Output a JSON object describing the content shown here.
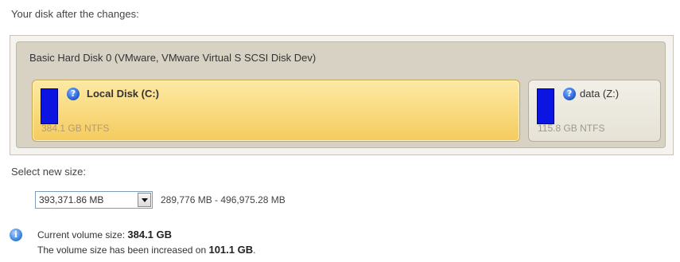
{
  "labels": {
    "after_changes": "Your disk after the changes:",
    "select_new_size": "Select new size:"
  },
  "disk": {
    "title": "Basic Hard Disk 0 (VMware, VMware Virtual S SCSI Disk Dev)",
    "partitions": [
      {
        "name": "Local Disk (C:)",
        "info": "384.1 GB NTFS",
        "help_icon": "question-icon",
        "bar_color": "#0b14e0",
        "selected": true
      },
      {
        "name": "data (Z:)",
        "info": "115.8 GB NTFS",
        "help_icon": "question-icon",
        "bar_color": "#0b14e0",
        "selected": false
      }
    ]
  },
  "size": {
    "value": "393,371.86 MB",
    "range": "289,776 MB - 496,975.28 MB",
    "dropdown_icon": "chevron-down-icon"
  },
  "info": {
    "icon": "info-icon",
    "line1_prefix": "Current volume size: ",
    "line1_value": "384.1 GB",
    "line2_prefix": "The volume size has been increased on ",
    "line2_value": "101.1 GB",
    "line2_suffix": "."
  },
  "colors": {
    "selected_partition": "#f9d97c",
    "disk_panel": "#d7d2c3",
    "volume_bar": "#0b14e0",
    "info_icon": "#3d86e0"
  }
}
